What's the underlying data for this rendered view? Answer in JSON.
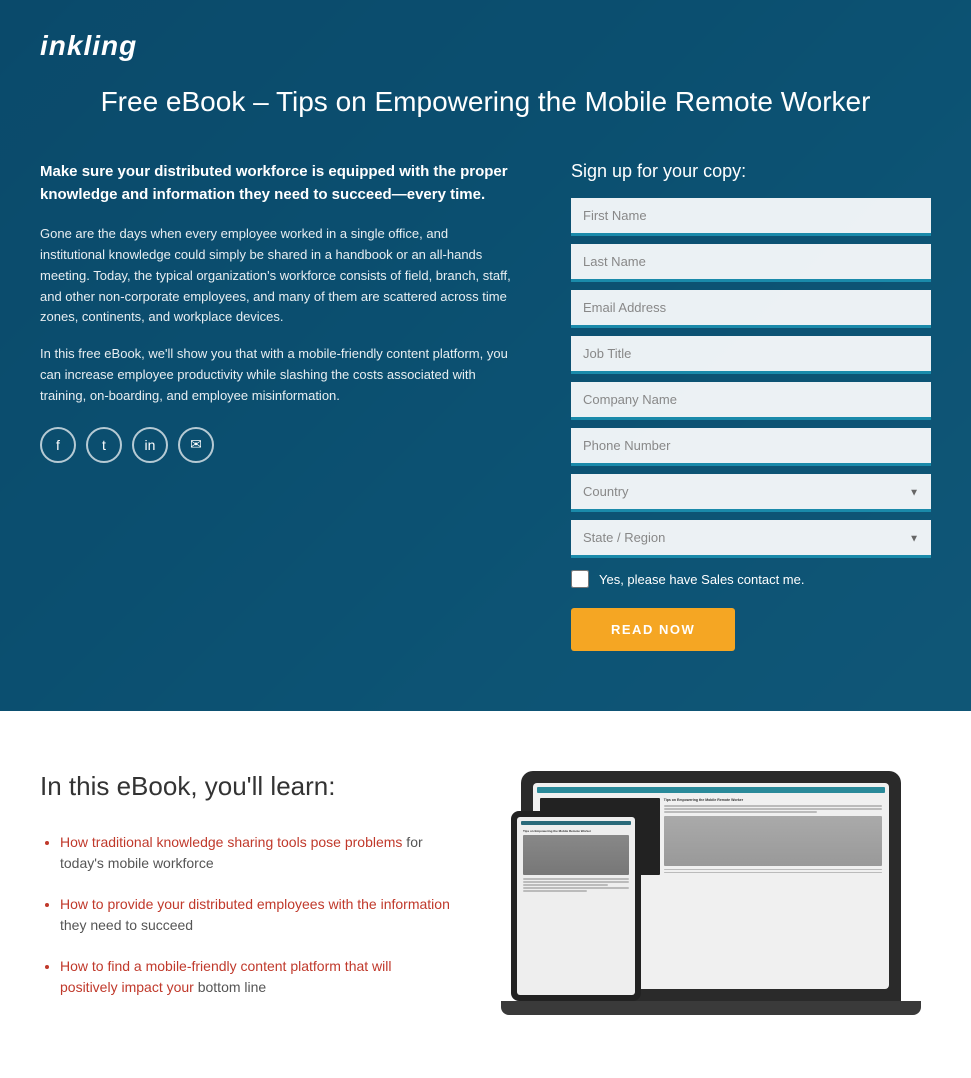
{
  "logo": {
    "text": "inkling"
  },
  "hero": {
    "title": "Free eBook – Tips on Empowering the Mobile Remote Worker",
    "left": {
      "bold_intro": "Make sure your distributed workforce is equipped with the proper knowledge and information they need to succeed—every time.",
      "para1": "Gone are the days when every employee worked in a single office, and institutional knowledge could simply be shared in a handbook or an all-hands meeting. Today, the typical organization's workforce consists of field, branch, staff, and other non-corporate employees, and many of them are scattered across time zones, continents, and workplace devices.",
      "para2": "In this free eBook, we'll show you that with a mobile-friendly content platform, you can increase employee productivity while slashing the costs associated with training, on-boarding, and employee misinformation."
    },
    "form": {
      "title": "Sign up for your copy:",
      "fields": {
        "first_name": "First Name",
        "last_name": "Last Name",
        "email": "Email Address",
        "job_title": "Job Title",
        "company_name": "Company Name",
        "phone": "Phone Number"
      },
      "dropdowns": {
        "country": "Country",
        "state": "State / Region"
      },
      "checkbox_label": "Yes, please have Sales contact me.",
      "button_label": "READ NOW"
    },
    "social": {
      "facebook": "f",
      "twitter": "t",
      "linkedin": "in",
      "email": "✉"
    }
  },
  "lower": {
    "title": "In this eBook, you'll learn:",
    "bullets": [
      {
        "colored_text": "How traditional knowledge sharing tools pose problems",
        "plain_text": " for today's mobile workforce"
      },
      {
        "colored_text": "How to provide your distributed employees with the information",
        "plain_text": " they need to succeed"
      },
      {
        "colored_text": "How to find a mobile-friendly content platform that will positively impact your",
        "plain_text": " bottom line"
      }
    ]
  }
}
